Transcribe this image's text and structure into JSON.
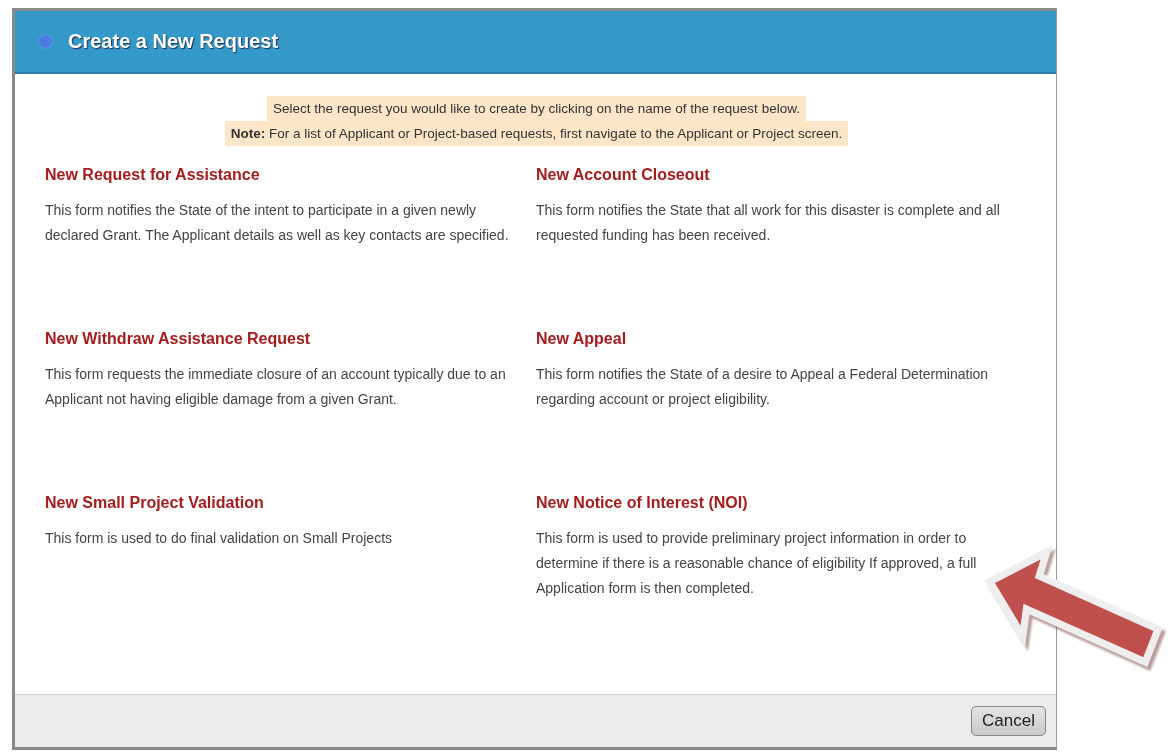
{
  "dialog": {
    "title": "Create a New Request"
  },
  "instructions": [
    "Select the request you would like to create by clicking on the name of the request below.",
    "**Note:** For a list of Applicant or Project-based requests, first navigate to the Applicant or Project screen."
  ],
  "requests": [
    {
      "title": "New Request for Assistance",
      "description": "This form notifies the State of the intent to participate in a given newly declared Grant. The Applicant details as well as key contacts are specified."
    },
    {
      "title": "New Account Closeout",
      "description": "This form notifies the State that all work for this disaster is complete and all requested funding has been received."
    },
    {
      "title": "New Withdraw Assistance Request",
      "description": "This form requests the immediate closure of an account typically due to an Applicant not having eligible damage from a given Grant."
    },
    {
      "title": "New Appeal",
      "description": "This form notifies the State of a desire to Appeal a Federal Determination regarding account or project eligibility."
    },
    {
      "title": "New Small Project Validation",
      "description": "This form is used to do final validation on Small Projects"
    },
    {
      "title": "New Notice of Interest (NOI)",
      "description": "This form is used to provide preliminary project information in order to determine if there is a reasonable chance of eligibility If approved, a full Application form is then completed."
    }
  ],
  "footer": {
    "buttons": [
      "Cancel"
    ]
  }
}
